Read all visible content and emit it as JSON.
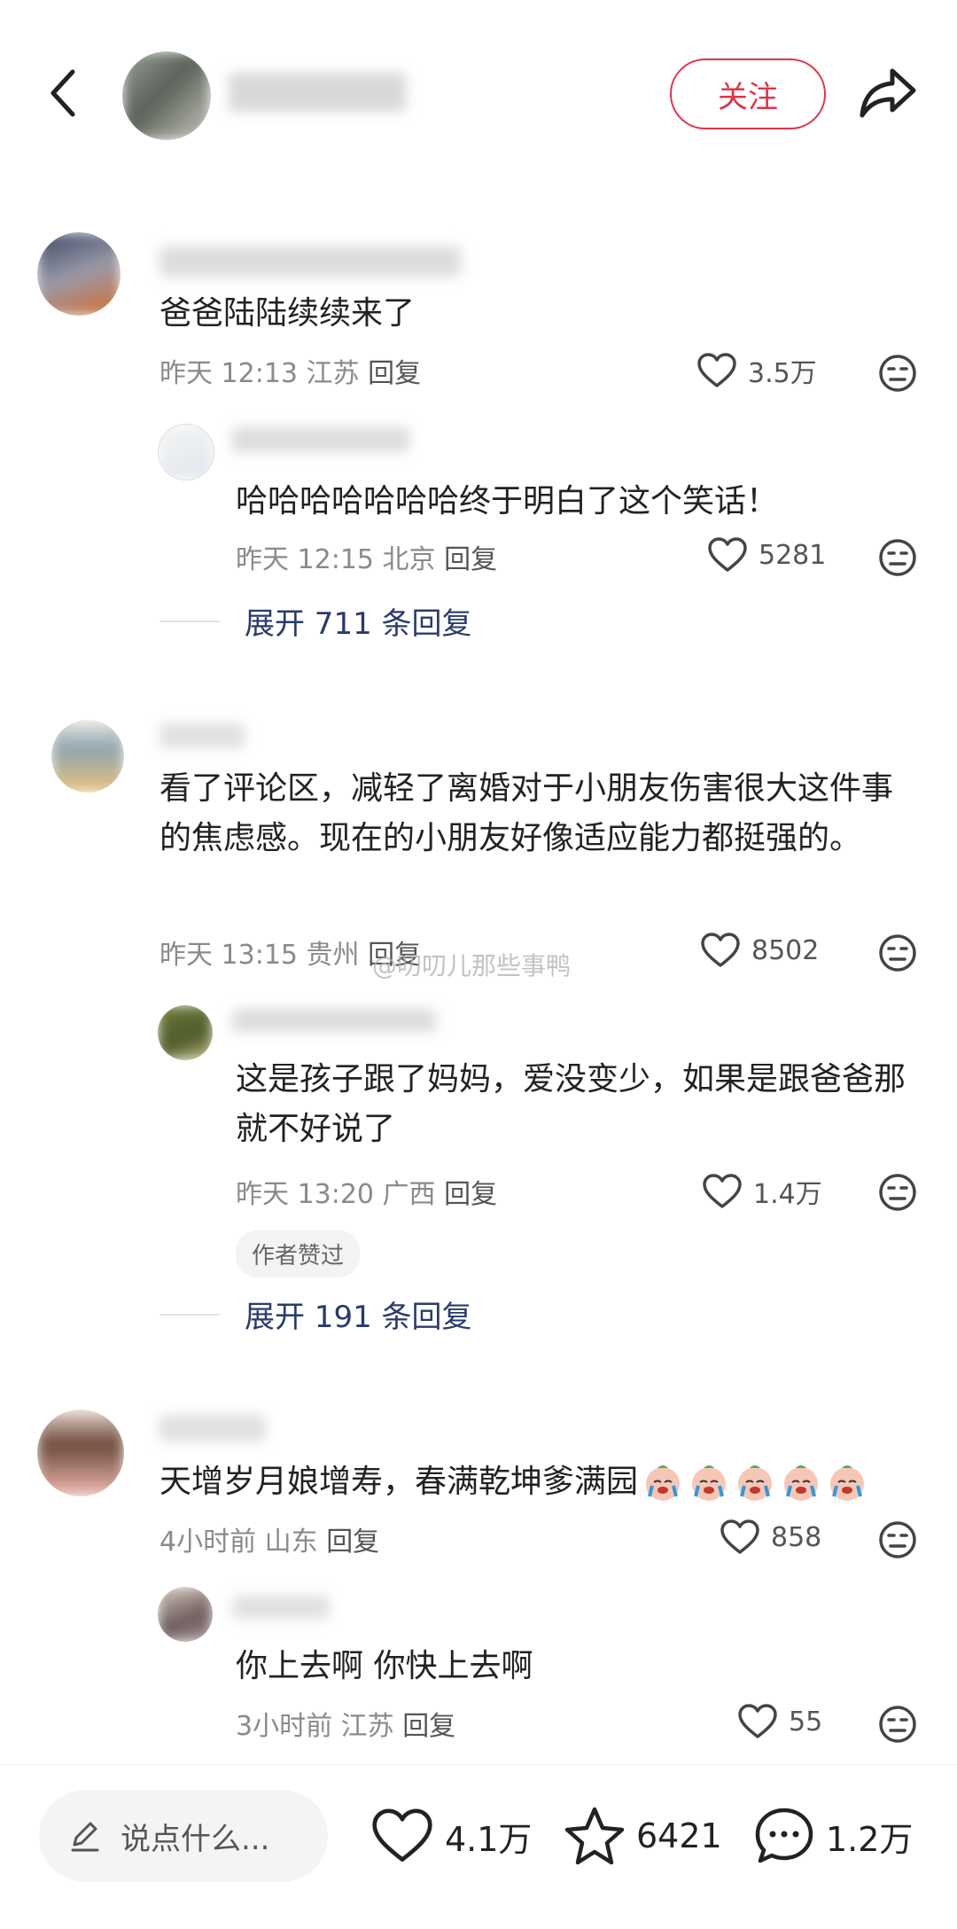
{
  "header": {
    "follow_label": "关注"
  },
  "watermark": "@叨叨儿那些事鸭",
  "comments": [
    {
      "text": "爸爸陆陆续续来了",
      "time": "昨天 12:13",
      "location": "江苏",
      "reply_label": "回复",
      "likes": "3.5万",
      "replies": [
        {
          "text": "哈哈哈哈哈哈哈终于明白了这个笑话！",
          "time": "昨天 12:15",
          "location": "北京",
          "reply_label": "回复",
          "likes": "5281"
        }
      ],
      "expand_label": "展开 711 条回复"
    },
    {
      "text": "看了评论区，减轻了离婚对于小朋友伤害很大这件事的焦虑感。现在的小朋友好像适应能力都挺强的。",
      "time": "昨天 13:15",
      "location": "贵州",
      "reply_label": "回复",
      "likes": "8502",
      "replies": [
        {
          "text": "这是孩子跟了妈妈，爱没变少，如果是跟爸爸那就不好说了",
          "time": "昨天 13:20",
          "location": "广西",
          "reply_label": "回复",
          "likes": "1.4万",
          "badge": "作者赞过"
        }
      ],
      "expand_label": "展开 191 条回复"
    },
    {
      "text": "天增岁月娘增寿，春满乾坤爹满园",
      "emoji_count": 5,
      "time": "4小时前",
      "location": "山东",
      "reply_label": "回复",
      "likes": "858",
      "replies": [
        {
          "text": "你上去啊 你快上去啊",
          "time": "3小时前",
          "location": "江苏",
          "reply_label": "回复",
          "likes": "55"
        }
      ]
    }
  ],
  "bottom_bar": {
    "input_placeholder": "说点什么...",
    "likes": "4.1万",
    "favorites": "6421",
    "comments": "1.2万"
  },
  "colors": {
    "accent": "#e0344a",
    "link": "#2a3b6b",
    "meta": "#8a8a8a"
  }
}
